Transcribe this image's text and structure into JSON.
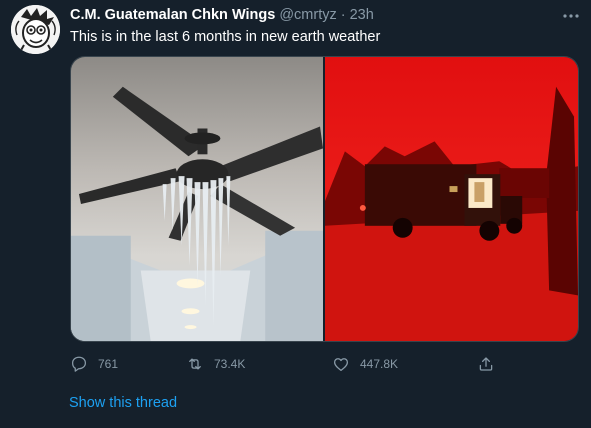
{
  "tweet": {
    "author_name": "C.M. Guatemalan Chkn Wings",
    "handle": "@cmrtyz",
    "separator": "·",
    "time": "23h",
    "text": "This is in the last 6 months in new earth weather"
  },
  "actions": {
    "replies": "761",
    "retweets": "73.4K",
    "likes": "447.8K"
  },
  "show_thread": "Show this thread",
  "colors": {
    "background": "#15202b",
    "link": "#1da1f2",
    "muted": "#8899a6"
  },
  "icons": [
    "avatar-illustration",
    "more-icon",
    "reply-icon",
    "retweet-icon",
    "like-icon",
    "share-icon"
  ]
}
